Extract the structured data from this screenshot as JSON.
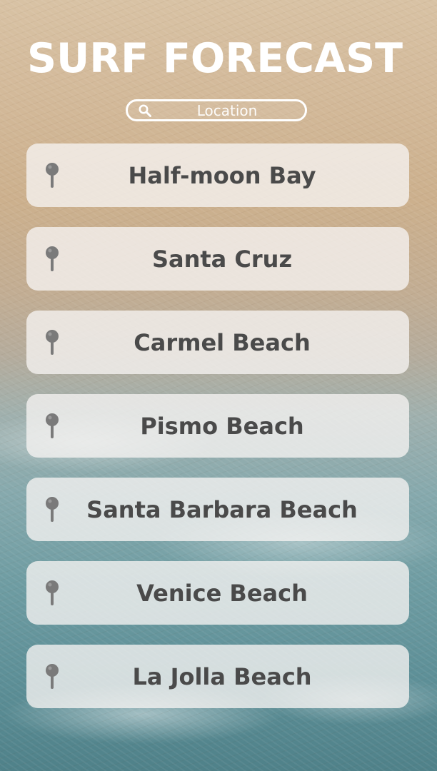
{
  "app": {
    "title": "SURF FORECAST"
  },
  "search": {
    "placeholder": "Location",
    "value": "",
    "icon": "search-icon"
  },
  "beaches": [
    {
      "label": "Half-moon Bay",
      "icon": "location-pin-icon"
    },
    {
      "label": "Santa Cruz",
      "icon": "location-pin-icon"
    },
    {
      "label": "Carmel Beach",
      "icon": "location-pin-icon"
    },
    {
      "label": "Pismo Beach",
      "icon": "location-pin-icon"
    },
    {
      "label": "Santa Barbara Beach",
      "icon": "location-pin-icon"
    },
    {
      "label": "Venice Beach",
      "icon": "location-pin-icon"
    },
    {
      "label": "La Jolla Beach",
      "icon": "location-pin-icon"
    }
  ],
  "colors": {
    "title": "#ffffff",
    "card_text": "#4a4a4a",
    "pin": "#7a7a7a",
    "sand": "#d2b898",
    "ocean": "#5d8f97"
  }
}
